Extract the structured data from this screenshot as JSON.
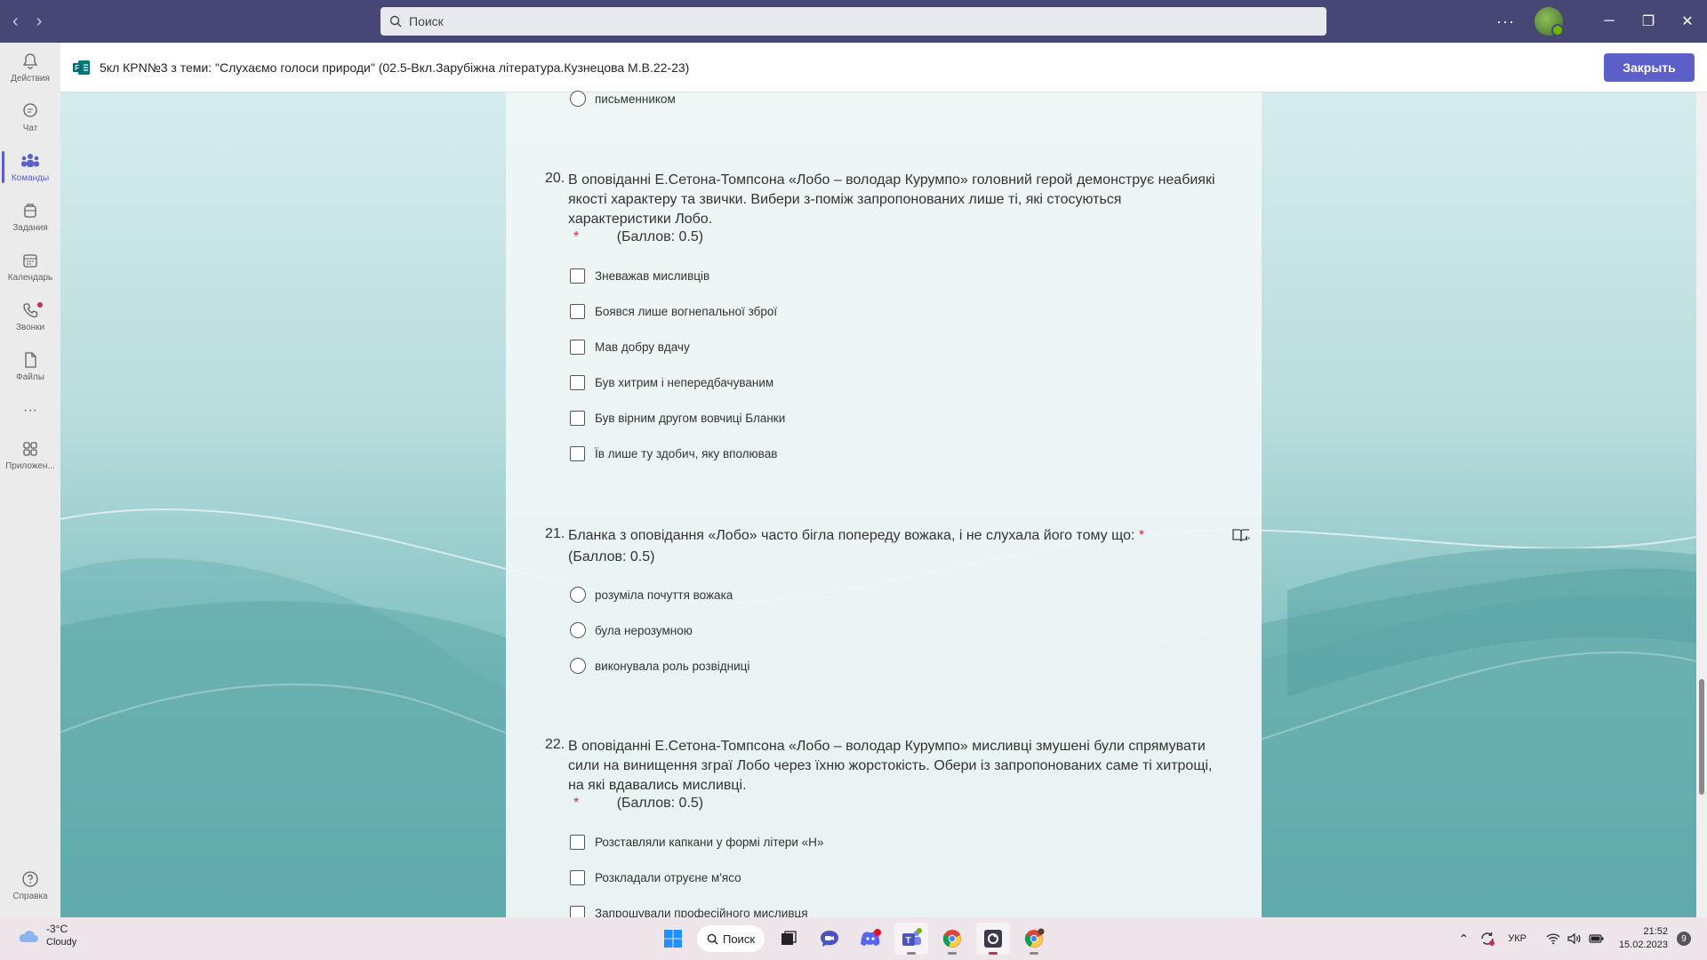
{
  "titlebar": {
    "search_placeholder": "Поиск"
  },
  "rail": [
    {
      "label": "Действия",
      "icon": "bell-icon"
    },
    {
      "label": "Чат",
      "icon": "chat-icon"
    },
    {
      "label": "Команды",
      "icon": "teams-icon",
      "active": true
    },
    {
      "label": "Задания",
      "icon": "assignments-icon"
    },
    {
      "label": "Календарь",
      "icon": "calendar-icon"
    },
    {
      "label": "Звонки",
      "icon": "phone-icon"
    },
    {
      "label": "Файлы",
      "icon": "file-icon"
    },
    {
      "label": "Приложен...",
      "icon": "apps-icon"
    },
    {
      "label": "Справка",
      "icon": "help-icon"
    }
  ],
  "header": {
    "title": "5кл КРN№3 з теми: \"Слухаємо голоси природи\" (02.5-Вкл.Зарубіжна література.Кузнецова М.В.22-23)",
    "close_label": "Закрыть"
  },
  "form": {
    "prev_option": "письменником",
    "q20": {
      "number": "20.",
      "text": "В оповіданні Е.Сетона-Томпсона «Лобо – володар Курумпо» головний герой демонструє неабиякі якості характеру та звички. Вибери з-поміж запропонованих лише ті, які стосуються характеристики Лобо.",
      "required": "*",
      "points": "(Баллов: 0.5)",
      "options": [
        "Зневажав мисливців",
        "Боявся лише вогнепальної зброї",
        "Мав добру вдачу",
        "Був хитрим і непередбачуваним",
        "Був вірним другом вовчиці Бланки",
        "Їв лише ту здобич, яку вполював"
      ]
    },
    "q21": {
      "number": "21.",
      "text": "Бланка з оповідання  «Лобо» часто бігла попереду вожака, і не слухала його тому що:",
      "required": "*",
      "points": "(Баллов: 0.5)",
      "options": [
        "розуміла почуття вожака",
        "була нерозумною",
        "виконувала роль розвідниці"
      ]
    },
    "q22": {
      "number": "22.",
      "text": "В оповіданні Е.Сетона-Томпсона «Лобо – володар Курумпо» мисливці змушені були спрямувати сили на винищення зграї Лобо через їхню жорстокість. Обери із запропонованих саме ті хитрощі, на які вдавались мисливці.",
      "required": "*",
      "points": "(Баллов: 0.5)",
      "options": [
        "Розставляли капкани у формі літери «Н»",
        "Розкладали отруєне м'ясо",
        "Запрошували професійного мисливця"
      ]
    }
  },
  "taskbar": {
    "weather_temp": "-3°C",
    "weather_desc": "Cloudy",
    "search_label": "Поиск",
    "lang": "УКР",
    "time": "21:52",
    "date": "15.02.2023",
    "notifications": "9"
  },
  "colors": {
    "titlebar": "#464775",
    "accent": "#5b5fc7",
    "required": "#c4314b"
  }
}
